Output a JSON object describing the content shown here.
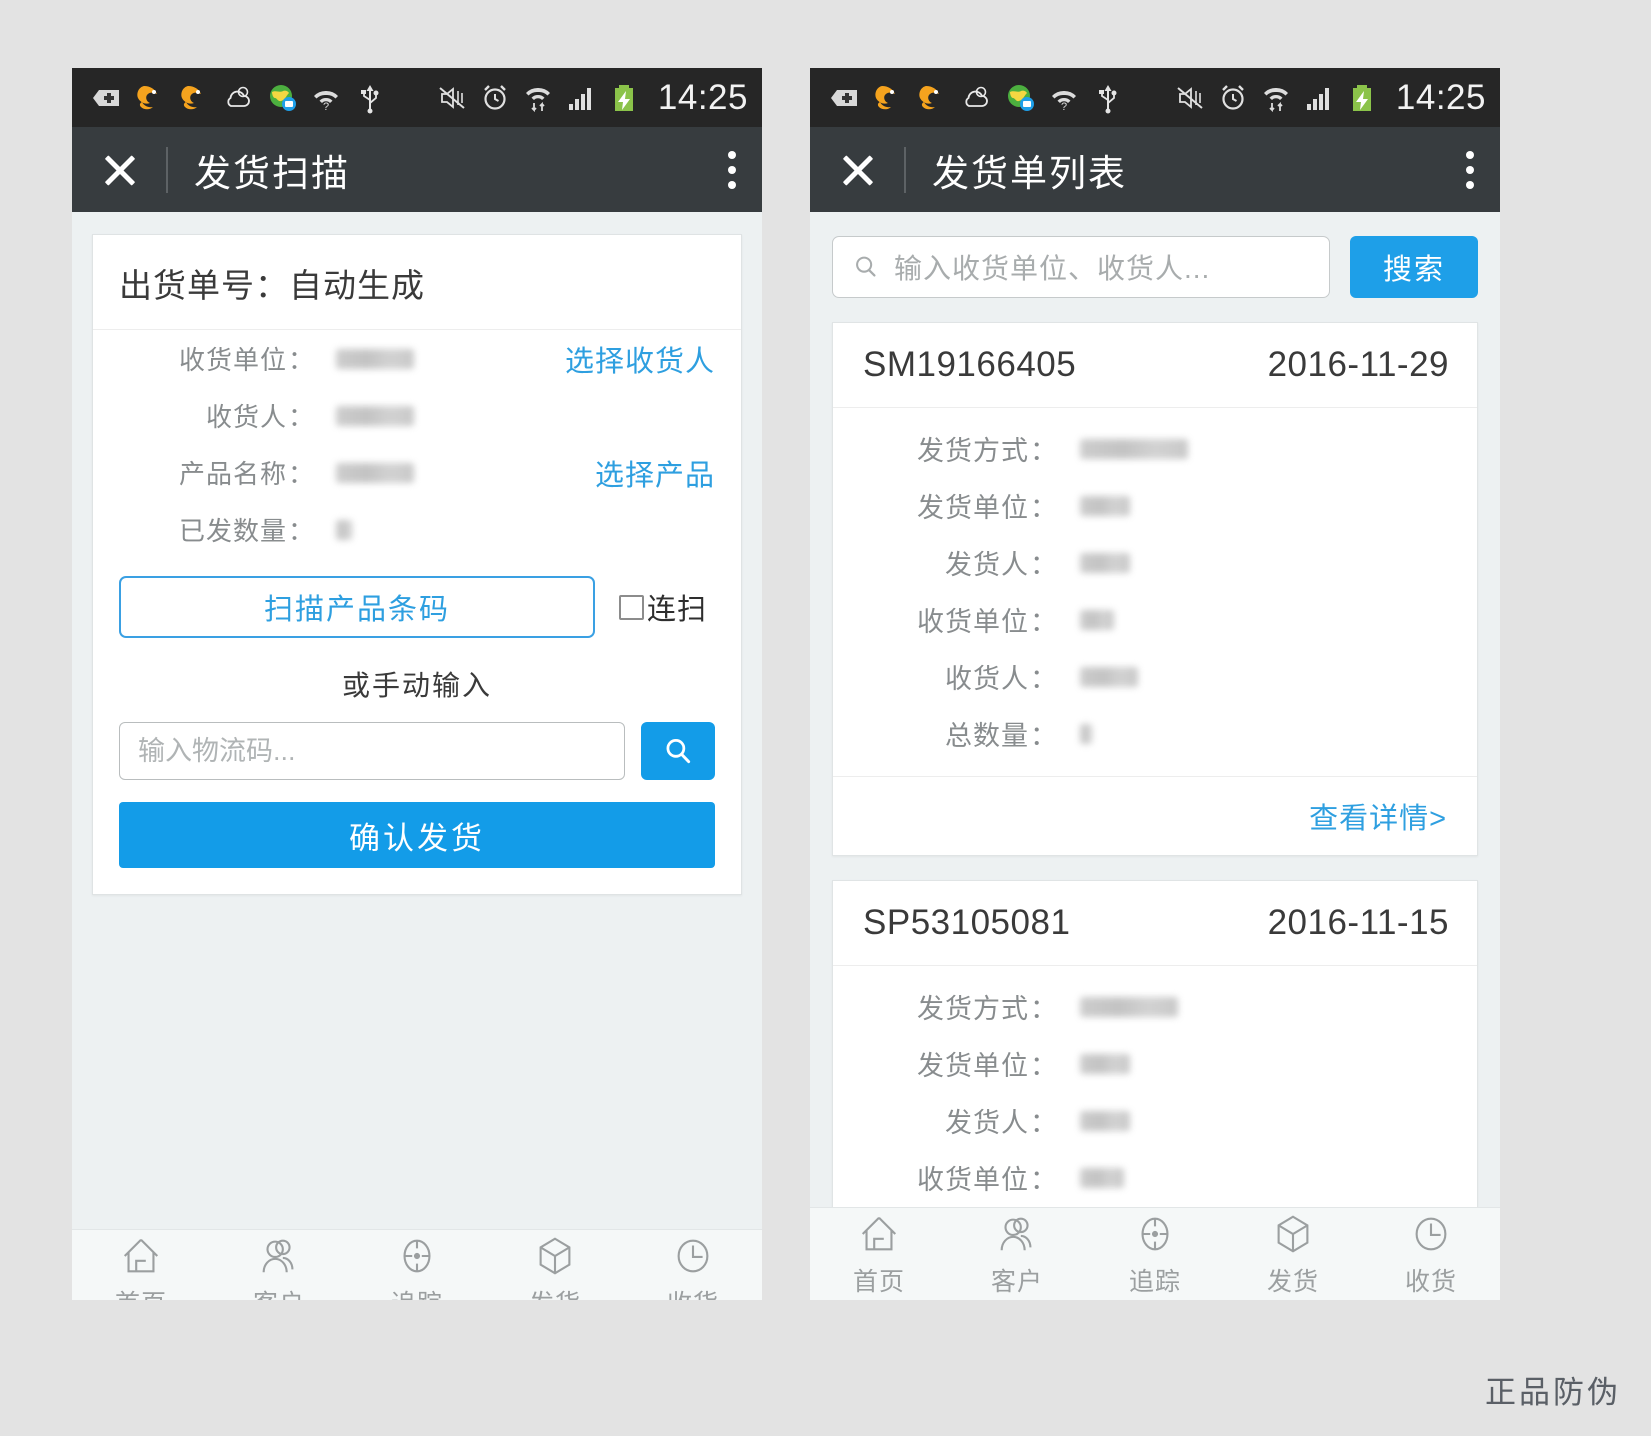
{
  "statusbar": {
    "time": "14:25",
    "icons": [
      "plus-badge-icon",
      "uc-browser-icon",
      "uc-browser-icon",
      "weather-cloud-icon",
      "map-globe-icon",
      "wifi-question-icon",
      "usb-icon"
    ],
    "right_icons": [
      "mute-vibrate-icon",
      "alarm-clock-icon",
      "wifi-data-arrows-icon",
      "signal-bars-icon",
      "battery-charging-icon"
    ]
  },
  "left_screen": {
    "titlebar": {
      "title": "发货扫描",
      "close_label": "close-icon",
      "menu_label": "overflow-menu-icon"
    },
    "card_title": "出货单号：自动生成",
    "fields": [
      {
        "label": "收货单位",
        "value": "",
        "redacted": true,
        "redact_w": 78,
        "action": "选择收货人"
      },
      {
        "label": "收货人",
        "value": "",
        "redacted": true,
        "redact_w": 78,
        "action": ""
      },
      {
        "label": "产品名称",
        "value": "",
        "redacted": true,
        "redact_w": 78,
        "action": "选择产品"
      },
      {
        "label": "已发数量",
        "value": "",
        "redacted": true,
        "redact_w": 16,
        "action": ""
      }
    ],
    "scan_button": "扫描产品条码",
    "continuous_scan_label": "连扫",
    "continuous_scan_checked": false,
    "manual_hint": "或手动输入",
    "logistics_input": {
      "value": "",
      "placeholder": "输入物流码..."
    },
    "search_icon": "search-icon",
    "confirm_button": "确认发货"
  },
  "right_screen": {
    "titlebar": {
      "title": "发货单列表",
      "close_label": "close-icon",
      "menu_label": "overflow-menu-icon"
    },
    "search": {
      "placeholder": "输入收货单位、收货人...",
      "value": "",
      "button": "搜索",
      "icon": "search-icon"
    },
    "cards": [
      {
        "code": "SM19166405",
        "date": "2016-11-29",
        "rows": [
          {
            "label": "发货方式",
            "value": "",
            "redacted": true,
            "redact_w": 108
          },
          {
            "label": "发货单位",
            "value": "",
            "redacted": true,
            "redact_w": 50
          },
          {
            "label": "发货人",
            "value": "",
            "redacted": true,
            "redact_w": 50
          },
          {
            "label": "收货单位",
            "value": "",
            "redacted": true,
            "redact_w": 34
          },
          {
            "label": "收货人",
            "value": "",
            "redacted": true,
            "redact_w": 58
          },
          {
            "label": "总数量",
            "value": "",
            "redacted": true,
            "redact_w": 12
          }
        ],
        "detail_link": "查看详情>"
      },
      {
        "code": "SP53105081",
        "date": "2016-11-15",
        "rows": [
          {
            "label": "发货方式",
            "value": "",
            "redacted": true,
            "redact_w": 98
          },
          {
            "label": "发货单位",
            "value": "",
            "redacted": true,
            "redact_w": 50
          },
          {
            "label": "发货人",
            "value": "",
            "redacted": true,
            "redact_w": 50
          },
          {
            "label": "收货单位",
            "value": "",
            "redacted": true,
            "redact_w": 44
          }
        ],
        "detail_link": ""
      }
    ]
  },
  "tabbar": {
    "items": [
      {
        "label": "首页",
        "icon": "home-icon"
      },
      {
        "label": "客户",
        "icon": "customers-icon"
      },
      {
        "label": "追踪",
        "icon": "tracking-target-icon"
      },
      {
        "label": "发货",
        "icon": "shipment-box-icon"
      },
      {
        "label": "收货",
        "icon": "receive-clock-icon"
      }
    ]
  },
  "watermark": "正品防伪",
  "colors": {
    "accent": "#139ce8",
    "link": "#2e9fe0",
    "titlebar": "#373c3f",
    "statusbar": "#262626",
    "page_bg": "#e3e3e3",
    "screen_bg": "#edf1f2"
  }
}
